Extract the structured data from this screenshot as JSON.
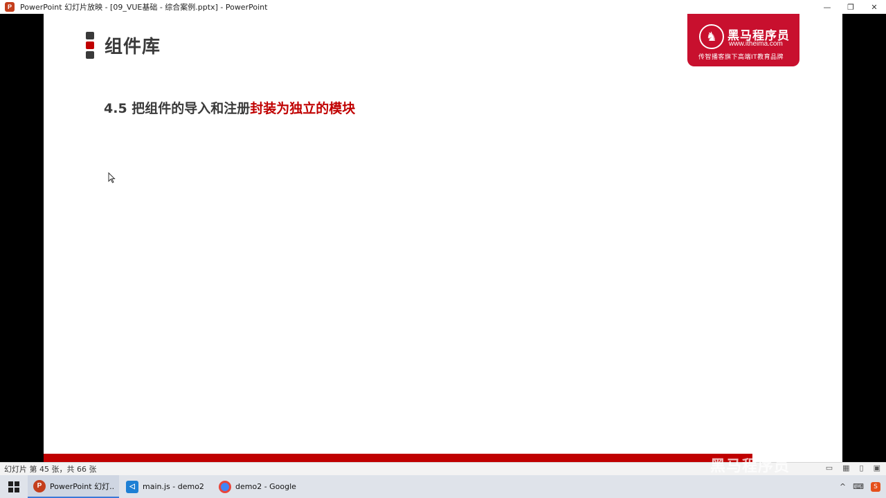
{
  "window": {
    "title": "PowerPoint 幻灯片放映 - [09_VUE基础 - 综合案例.pptx] - PowerPoint",
    "minimize_glyph": "—",
    "restore_glyph": "❐",
    "close_glyph": "✕"
  },
  "slide": {
    "title": "组件库",
    "subtitle_prefix": "4.5 把组件的导入和注册",
    "subtitle_highlight": "封装为独立的模块",
    "logo": {
      "brand": "黑马程序员",
      "url": "www.itheima.com",
      "slogan": "传智播客旗下高端IT教育品牌"
    }
  },
  "statusbar": {
    "slide_count": "幻灯片 第 45 张，共 66 张"
  },
  "watermark": "黑马程序员",
  "taskbar": {
    "items": [
      {
        "label": "PowerPoint 幻灯...",
        "icon": "powerpoint-icon",
        "color": "#c43e1c"
      },
      {
        "label": "main.js - demo2 -...",
        "icon": "vscode-icon",
        "color": "#1e7fd4"
      },
      {
        "label": "demo2 - Google ...",
        "icon": "chrome-icon",
        "color": "#4285f4"
      }
    ],
    "tray_chevron": "^"
  },
  "colors": {
    "accent_red": "#c00000",
    "logo_red": "#c8102e"
  }
}
